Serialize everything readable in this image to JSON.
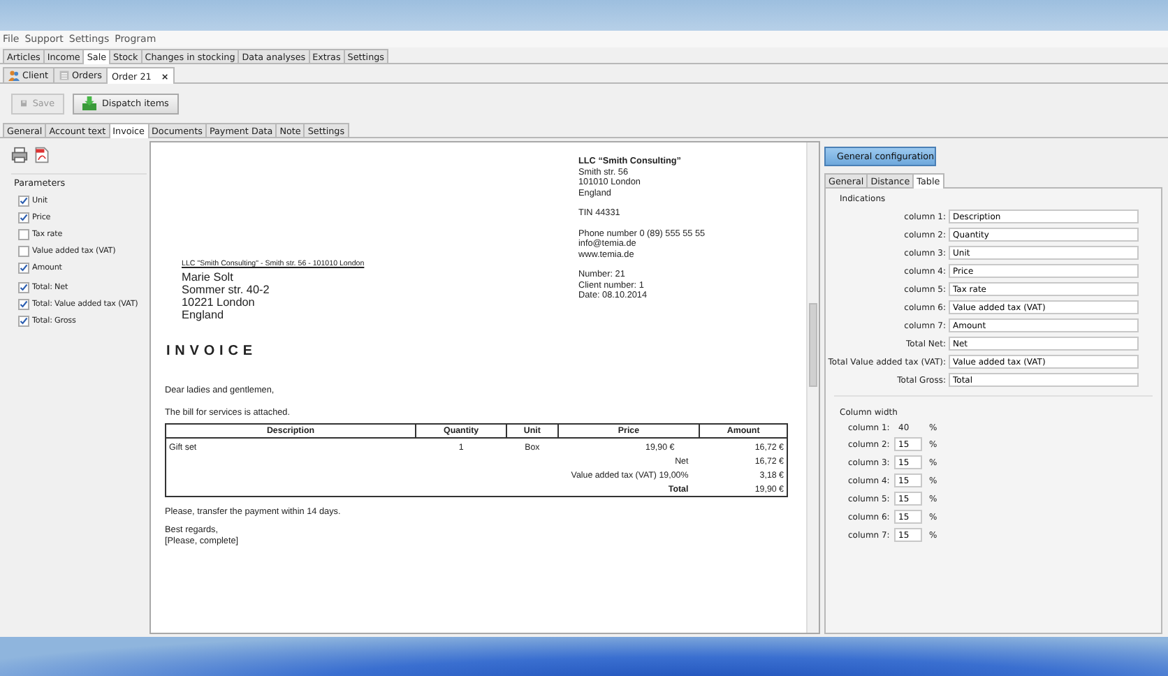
{
  "menu": [
    "File",
    "Support",
    "Settings",
    "Program"
  ],
  "main_tabs": [
    {
      "label": "Articles",
      "selected": false
    },
    {
      "label": "Income",
      "selected": false
    },
    {
      "label": "Sale",
      "selected": true
    },
    {
      "label": "Stock",
      "selected": false
    },
    {
      "label": "Changes in stocking",
      "selected": false
    },
    {
      "label": "Data analyses",
      "selected": false
    },
    {
      "label": "Extras",
      "selected": false
    },
    {
      "label": "Settings",
      "selected": false
    }
  ],
  "sub_tabs": [
    {
      "label": "Client",
      "selected": false,
      "kind": "client"
    },
    {
      "label": "Orders",
      "selected": false,
      "kind": "orders"
    },
    {
      "label": "Order 21",
      "selected": true,
      "kind": "doc",
      "close": "×"
    }
  ],
  "toolbar": [
    {
      "label": "Save",
      "disabled": true,
      "kind": "save"
    },
    {
      "label": "Dispatch items",
      "disabled": false,
      "kind": "dispatch"
    }
  ],
  "section_tabs": [
    {
      "label": "General",
      "selected": false
    },
    {
      "label": "Account text",
      "selected": false
    },
    {
      "label": "Invoice",
      "selected": true
    },
    {
      "label": "Documents",
      "selected": false
    },
    {
      "label": "Payment Data",
      "selected": false
    },
    {
      "label": "Note",
      "selected": false
    },
    {
      "label": "Settings",
      "selected": false
    }
  ],
  "parameters": {
    "title": "Parameters",
    "groups": [
      [
        {
          "label": "Unit",
          "checked": true
        },
        {
          "label": "Price",
          "checked": true
        },
        {
          "label": "Tax rate",
          "checked": false
        },
        {
          "label": "Value added tax (VAT)",
          "checked": false
        },
        {
          "label": "Amount",
          "checked": true
        }
      ],
      [
        {
          "label": "Total: Net",
          "checked": true
        },
        {
          "label": "Total: Value added tax (VAT)",
          "checked": true
        },
        {
          "label": "Total: Gross",
          "checked": true
        }
      ]
    ]
  },
  "invoice": {
    "company_name": "LLC “Smith Consulting”",
    "company_address": [
      "Smith str. 56",
      "101010 London",
      "England"
    ],
    "tin": "TIN 44331",
    "contacts": [
      "Phone number 0 (89) 555 55 55",
      "info@temia.de",
      "www.temia.de"
    ],
    "numbers": [
      "Number: 21",
      "Client number: 1",
      "Date: 08.10.2014"
    ],
    "sender_line": "LLC \"Smith Consulting\" - Smith str. 56 - 101010 London",
    "recipient": [
      "Marie Solt",
      "Sommer str. 40-2",
      "10221 London",
      "England"
    ],
    "title": "INVOICE",
    "greeting": "Dear ladies and gentlemen,",
    "intro": "The bill for services is attached.",
    "columns": [
      "Description",
      "Quantity",
      "Unit",
      "Price",
      "Amount"
    ],
    "rows": [
      [
        "Gift set",
        "1",
        "Box",
        "19,90 €",
        "16,72 €"
      ]
    ],
    "summary": [
      {
        "label": "Net",
        "value": "16,72 €",
        "bold": false
      },
      {
        "label": "Value added tax (VAT) 19,00%",
        "value": "3,18 €",
        "bold": false
      },
      {
        "label": "Total",
        "value": "19,90 €",
        "bold": true
      }
    ],
    "closing": [
      "Please, transfer the payment within 14 days."
    ],
    "regards": [
      "Best regards,",
      "[Please, complete]"
    ]
  },
  "config": {
    "button": "General configuration",
    "tabs": [
      {
        "label": "General",
        "selected": false
      },
      {
        "label": "Distance",
        "selected": false
      },
      {
        "label": "Table",
        "selected": true
      }
    ],
    "indications_title": "Indications",
    "indications": [
      {
        "label": "column 1:",
        "value": "Description"
      },
      {
        "label": "column 2:",
        "value": "Quantity"
      },
      {
        "label": "column 3:",
        "value": "Unit"
      },
      {
        "label": "column 4:",
        "value": "Price"
      },
      {
        "label": "column 5:",
        "value": "Tax rate"
      },
      {
        "label": "column 6:",
        "value": "Value added tax (VAT)"
      },
      {
        "label": "column 7:",
        "value": "Amount"
      },
      {
        "label": "Total Net:",
        "value": "Net"
      },
      {
        "label": "Total Value added tax (VAT):",
        "value": "Value added tax (VAT)"
      },
      {
        "label": "Total Gross:",
        "value": "Total"
      }
    ],
    "width_title": "Column width",
    "widths": [
      {
        "label": "column 1:",
        "value": "40",
        "unit": "%",
        "kind": "fixed"
      },
      {
        "label": "column 2:",
        "value": "15",
        "unit": "%",
        "kind": "input"
      },
      {
        "label": "column 3:",
        "value": "15",
        "unit": "%",
        "kind": "input"
      },
      {
        "label": "column 4:",
        "value": "15",
        "unit": "%",
        "kind": "input"
      },
      {
        "label": "column 5:",
        "value": "15",
        "unit": "%",
        "kind": "input"
      },
      {
        "label": "column 6:",
        "value": "15",
        "unit": "%",
        "kind": "input"
      },
      {
        "label": "column 7:",
        "value": "15",
        "unit": "%",
        "kind": "input"
      }
    ]
  }
}
